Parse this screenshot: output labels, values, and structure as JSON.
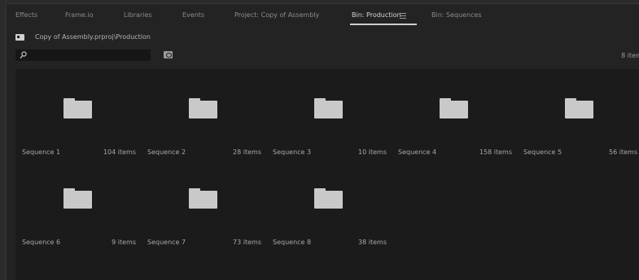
{
  "tabs": [
    {
      "label": "Effects"
    },
    {
      "label": "Frame.io"
    },
    {
      "label": "Libraries"
    },
    {
      "label": "Events"
    },
    {
      "label": "Project: Copy of Assembly"
    },
    {
      "label": "Bin: Production"
    },
    {
      "label": "Bin: Sequences"
    }
  ],
  "active_tab": "Bin: Production",
  "path": "Copy of Assembly.prproj\\Production",
  "search": {
    "value": "",
    "placeholder": ""
  },
  "item_count": "8 items",
  "items": [
    {
      "name": "Sequence 1",
      "count": "104 items"
    },
    {
      "name": "Sequence 2",
      "count": "28 items"
    },
    {
      "name": "Sequence 3",
      "count": "10 items"
    },
    {
      "name": "Sequence 4",
      "count": "158 items"
    },
    {
      "name": "Sequence 5",
      "count": "56 items"
    },
    {
      "name": "Sequence 6",
      "count": "9 items"
    },
    {
      "name": "Sequence 7",
      "count": "73 items"
    },
    {
      "name": "Sequence 8",
      "count": "38 items"
    }
  ],
  "icons": {
    "bin": "bin-icon",
    "search": "search-icon",
    "new_bin": "new-bin-icon",
    "folder": "folder-icon",
    "panel_menu": "panel-menu-icon"
  }
}
